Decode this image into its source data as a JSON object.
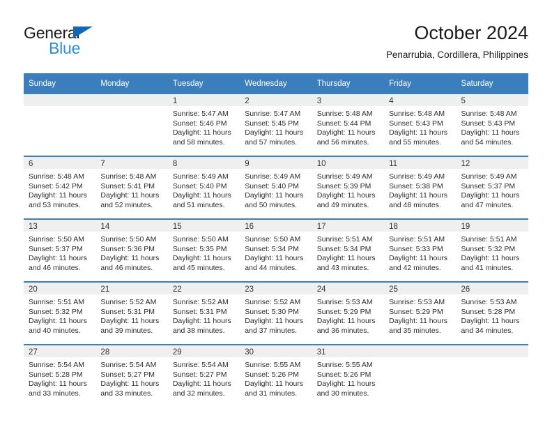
{
  "brand": {
    "name_top": "General",
    "name_bottom": "Blue",
    "accent_color": "#1268b3",
    "accent_color_light": "#2f8fd8"
  },
  "header": {
    "title": "October 2024",
    "subtitle": "Penarrubia, Cordillera, Philippines"
  },
  "theme": {
    "header_bg": "#3a7ebd",
    "daynum_bg": "#efefef",
    "rule_color": "#3a7ebd"
  },
  "weekdays": [
    "Sunday",
    "Monday",
    "Tuesday",
    "Wednesday",
    "Thursday",
    "Friday",
    "Saturday"
  ],
  "weeks": [
    [
      {
        "day": "",
        "sunrise": "",
        "sunset": "",
        "daylight1": "",
        "daylight2": "",
        "empty": true
      },
      {
        "day": "",
        "sunrise": "",
        "sunset": "",
        "daylight1": "",
        "daylight2": "",
        "empty": true
      },
      {
        "day": "1",
        "sunrise": "Sunrise: 5:47 AM",
        "sunset": "Sunset: 5:46 PM",
        "daylight1": "Daylight: 11 hours",
        "daylight2": "and 58 minutes."
      },
      {
        "day": "2",
        "sunrise": "Sunrise: 5:47 AM",
        "sunset": "Sunset: 5:45 PM",
        "daylight1": "Daylight: 11 hours",
        "daylight2": "and 57 minutes."
      },
      {
        "day": "3",
        "sunrise": "Sunrise: 5:48 AM",
        "sunset": "Sunset: 5:44 PM",
        "daylight1": "Daylight: 11 hours",
        "daylight2": "and 56 minutes."
      },
      {
        "day": "4",
        "sunrise": "Sunrise: 5:48 AM",
        "sunset": "Sunset: 5:43 PM",
        "daylight1": "Daylight: 11 hours",
        "daylight2": "and 55 minutes."
      },
      {
        "day": "5",
        "sunrise": "Sunrise: 5:48 AM",
        "sunset": "Sunset: 5:43 PM",
        "daylight1": "Daylight: 11 hours",
        "daylight2": "and 54 minutes."
      }
    ],
    [
      {
        "day": "6",
        "sunrise": "Sunrise: 5:48 AM",
        "sunset": "Sunset: 5:42 PM",
        "daylight1": "Daylight: 11 hours",
        "daylight2": "and 53 minutes."
      },
      {
        "day": "7",
        "sunrise": "Sunrise: 5:48 AM",
        "sunset": "Sunset: 5:41 PM",
        "daylight1": "Daylight: 11 hours",
        "daylight2": "and 52 minutes."
      },
      {
        "day": "8",
        "sunrise": "Sunrise: 5:49 AM",
        "sunset": "Sunset: 5:40 PM",
        "daylight1": "Daylight: 11 hours",
        "daylight2": "and 51 minutes."
      },
      {
        "day": "9",
        "sunrise": "Sunrise: 5:49 AM",
        "sunset": "Sunset: 5:40 PM",
        "daylight1": "Daylight: 11 hours",
        "daylight2": "and 50 minutes."
      },
      {
        "day": "10",
        "sunrise": "Sunrise: 5:49 AM",
        "sunset": "Sunset: 5:39 PM",
        "daylight1": "Daylight: 11 hours",
        "daylight2": "and 49 minutes."
      },
      {
        "day": "11",
        "sunrise": "Sunrise: 5:49 AM",
        "sunset": "Sunset: 5:38 PM",
        "daylight1": "Daylight: 11 hours",
        "daylight2": "and 48 minutes."
      },
      {
        "day": "12",
        "sunrise": "Sunrise: 5:49 AM",
        "sunset": "Sunset: 5:37 PM",
        "daylight1": "Daylight: 11 hours",
        "daylight2": "and 47 minutes."
      }
    ],
    [
      {
        "day": "13",
        "sunrise": "Sunrise: 5:50 AM",
        "sunset": "Sunset: 5:37 PM",
        "daylight1": "Daylight: 11 hours",
        "daylight2": "and 46 minutes."
      },
      {
        "day": "14",
        "sunrise": "Sunrise: 5:50 AM",
        "sunset": "Sunset: 5:36 PM",
        "daylight1": "Daylight: 11 hours",
        "daylight2": "and 46 minutes."
      },
      {
        "day": "15",
        "sunrise": "Sunrise: 5:50 AM",
        "sunset": "Sunset: 5:35 PM",
        "daylight1": "Daylight: 11 hours",
        "daylight2": "and 45 minutes."
      },
      {
        "day": "16",
        "sunrise": "Sunrise: 5:50 AM",
        "sunset": "Sunset: 5:34 PM",
        "daylight1": "Daylight: 11 hours",
        "daylight2": "and 44 minutes."
      },
      {
        "day": "17",
        "sunrise": "Sunrise: 5:51 AM",
        "sunset": "Sunset: 5:34 PM",
        "daylight1": "Daylight: 11 hours",
        "daylight2": "and 43 minutes."
      },
      {
        "day": "18",
        "sunrise": "Sunrise: 5:51 AM",
        "sunset": "Sunset: 5:33 PM",
        "daylight1": "Daylight: 11 hours",
        "daylight2": "and 42 minutes."
      },
      {
        "day": "19",
        "sunrise": "Sunrise: 5:51 AM",
        "sunset": "Sunset: 5:32 PM",
        "daylight1": "Daylight: 11 hours",
        "daylight2": "and 41 minutes."
      }
    ],
    [
      {
        "day": "20",
        "sunrise": "Sunrise: 5:51 AM",
        "sunset": "Sunset: 5:32 PM",
        "daylight1": "Daylight: 11 hours",
        "daylight2": "and 40 minutes."
      },
      {
        "day": "21",
        "sunrise": "Sunrise: 5:52 AM",
        "sunset": "Sunset: 5:31 PM",
        "daylight1": "Daylight: 11 hours",
        "daylight2": "and 39 minutes."
      },
      {
        "day": "22",
        "sunrise": "Sunrise: 5:52 AM",
        "sunset": "Sunset: 5:31 PM",
        "daylight1": "Daylight: 11 hours",
        "daylight2": "and 38 minutes."
      },
      {
        "day": "23",
        "sunrise": "Sunrise: 5:52 AM",
        "sunset": "Sunset: 5:30 PM",
        "daylight1": "Daylight: 11 hours",
        "daylight2": "and 37 minutes."
      },
      {
        "day": "24",
        "sunrise": "Sunrise: 5:53 AM",
        "sunset": "Sunset: 5:29 PM",
        "daylight1": "Daylight: 11 hours",
        "daylight2": "and 36 minutes."
      },
      {
        "day": "25",
        "sunrise": "Sunrise: 5:53 AM",
        "sunset": "Sunset: 5:29 PM",
        "daylight1": "Daylight: 11 hours",
        "daylight2": "and 35 minutes."
      },
      {
        "day": "26",
        "sunrise": "Sunrise: 5:53 AM",
        "sunset": "Sunset: 5:28 PM",
        "daylight1": "Daylight: 11 hours",
        "daylight2": "and 34 minutes."
      }
    ],
    [
      {
        "day": "27",
        "sunrise": "Sunrise: 5:54 AM",
        "sunset": "Sunset: 5:28 PM",
        "daylight1": "Daylight: 11 hours",
        "daylight2": "and 33 minutes."
      },
      {
        "day": "28",
        "sunrise": "Sunrise: 5:54 AM",
        "sunset": "Sunset: 5:27 PM",
        "daylight1": "Daylight: 11 hours",
        "daylight2": "and 33 minutes."
      },
      {
        "day": "29",
        "sunrise": "Sunrise: 5:54 AM",
        "sunset": "Sunset: 5:27 PM",
        "daylight1": "Daylight: 11 hours",
        "daylight2": "and 32 minutes."
      },
      {
        "day": "30",
        "sunrise": "Sunrise: 5:55 AM",
        "sunset": "Sunset: 5:26 PM",
        "daylight1": "Daylight: 11 hours",
        "daylight2": "and 31 minutes."
      },
      {
        "day": "31",
        "sunrise": "Sunrise: 5:55 AM",
        "sunset": "Sunset: 5:26 PM",
        "daylight1": "Daylight: 11 hours",
        "daylight2": "and 30 minutes."
      },
      {
        "day": "",
        "sunrise": "",
        "sunset": "",
        "daylight1": "",
        "daylight2": "",
        "empty": true
      },
      {
        "day": "",
        "sunrise": "",
        "sunset": "",
        "daylight1": "",
        "daylight2": "",
        "empty": true
      }
    ]
  ]
}
